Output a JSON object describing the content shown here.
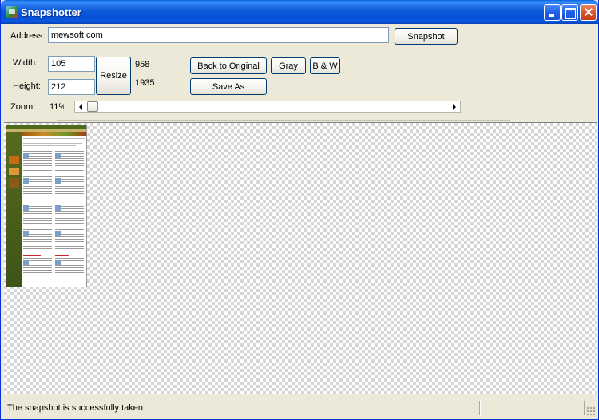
{
  "window": {
    "title": "Snapshotter"
  },
  "icons": {
    "app": "app-icon",
    "minimize": "minimize-icon",
    "maximize": "maximize-icon",
    "close": "close-icon",
    "slider_left": "arrow-left-icon",
    "slider_right": "arrow-right-icon"
  },
  "address": {
    "label": "Address:",
    "value": "mewsoft.com",
    "snapshot_button": "Snapshot"
  },
  "size": {
    "width_label": "Width:",
    "width_value": "105",
    "height_label": "Height:",
    "height_value": "212",
    "resize_button": "Resize",
    "original_width": "958",
    "original_height": "1935"
  },
  "actions": {
    "back_to_original": "Back to Original",
    "gray": "Gray",
    "bw": "B & W",
    "save_as": "Save As"
  },
  "zoom": {
    "label": "Zoom:",
    "value": "11%",
    "level_fraction": 0.11
  },
  "status": {
    "message": "The snapshot is successfully taken"
  },
  "colors": {
    "titlebar": "#0a57de",
    "window_face": "#ece9d8",
    "button_border": "#003c74",
    "input_border": "#7f9db9"
  }
}
